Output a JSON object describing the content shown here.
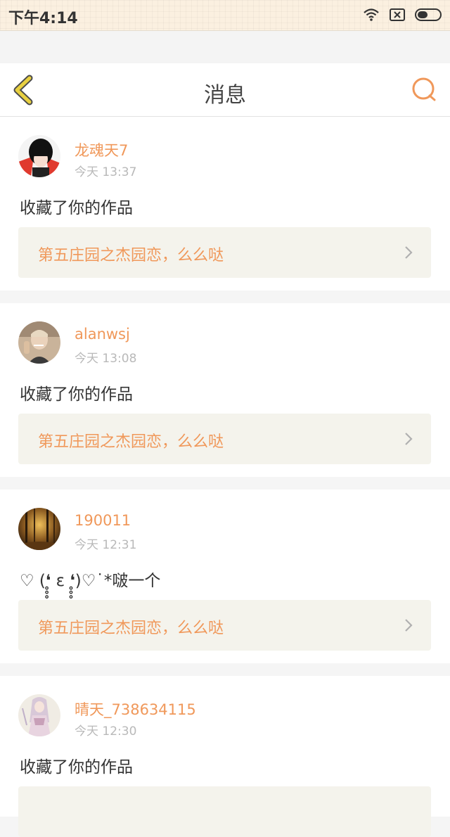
{
  "status_bar": {
    "time": "下午4:14",
    "icons": [
      "wifi-icon",
      "no-sim-icon",
      "battery-icon"
    ]
  },
  "nav": {
    "title": "消息",
    "back_icon": "chevron-left-icon",
    "search_icon": "search-icon"
  },
  "colors": {
    "accent": "#f0985a",
    "back_icon": "#e8d040",
    "card_link_bg": "#f4f3ec"
  },
  "messages": [
    {
      "username": "龙魂天7",
      "time": "今天 13:37",
      "text": "收藏了你的作品",
      "work_title": "第五庄园之杰园恋，么么哒"
    },
    {
      "username": "alanwsj",
      "time": "今天 13:08",
      "text": "收藏了你的作品",
      "work_title": "第五庄园之杰园恋，么么哒"
    },
    {
      "username": "190011",
      "time": "今天 12:31",
      "text": "♡ (❛̥̥̥ ε ❛̥̥̥)♡˙*啵一个",
      "work_title": "第五庄园之杰园恋，么么哒"
    },
    {
      "username": "晴天_738634115",
      "time": "今天 12:30",
      "text": "收藏了你的作品",
      "work_title": ""
    }
  ]
}
